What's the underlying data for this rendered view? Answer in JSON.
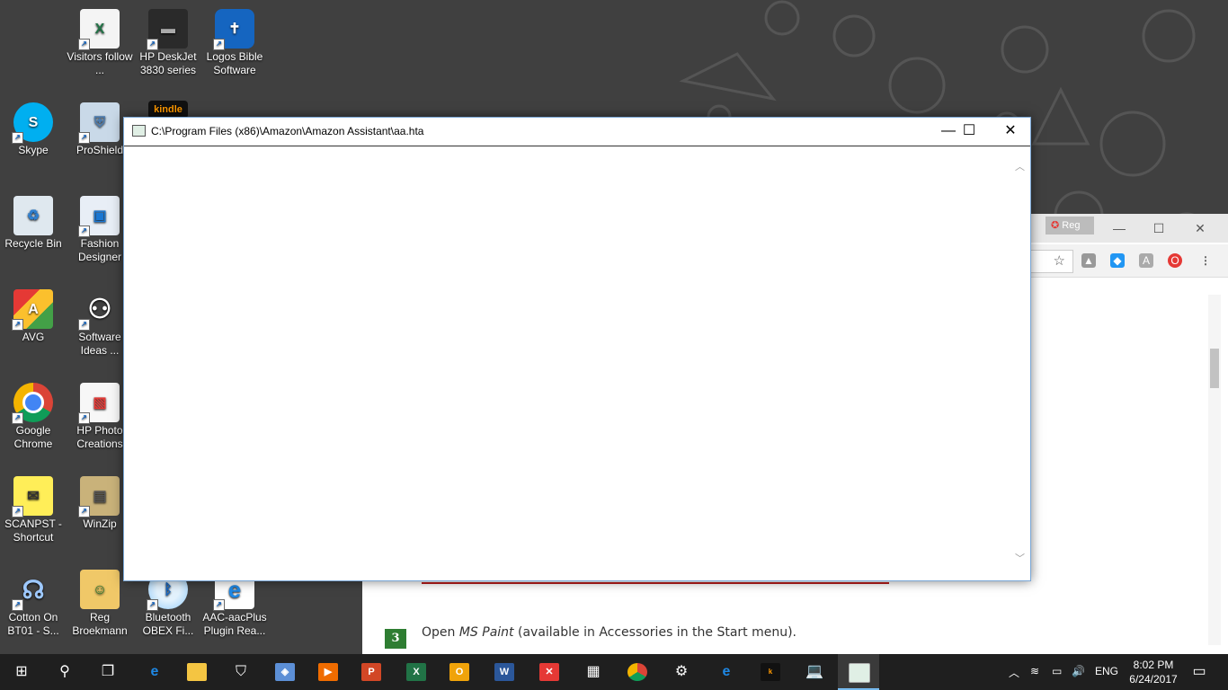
{
  "desktop": {
    "icons": [
      {
        "label": "Visitors follow ...",
        "icon": "excel-file-icon"
      },
      {
        "label": "HP DeskJet 3830 series",
        "icon": "printer-icon"
      },
      {
        "label": "Logos Bible Software",
        "icon": "logos-icon"
      },
      {
        "label": "Skype",
        "icon": "skype-icon"
      },
      {
        "label": "ProShield",
        "icon": "shield-icon"
      },
      {
        "label": "kindle",
        "icon": "kindle-icon"
      },
      {
        "label": "Recycle Bin",
        "icon": "recycle-bin-icon"
      },
      {
        "label": "Fashion Designer",
        "icon": "fashion-designer-icon"
      },
      {
        "label": "AVG",
        "icon": "avg-icon"
      },
      {
        "label": "Software Ideas ...",
        "icon": "software-ideas-icon"
      },
      {
        "label": "Google Chrome",
        "icon": "chrome-icon"
      },
      {
        "label": "HP Photo Creations",
        "icon": "hp-photo-icon"
      },
      {
        "label": "SCANPST - Shortcut",
        "icon": "scanpst-icon"
      },
      {
        "label": "WinZip",
        "icon": "winzip-icon"
      },
      {
        "label": "Cotton On BT01 - S...",
        "icon": "headset-icon"
      },
      {
        "label": "Reg Broekmann",
        "icon": "user-folder-icon"
      },
      {
        "label": "Bluetooth OBEX Fi...",
        "icon": "bluetooth-icon"
      },
      {
        "label": "AAC-aacPlus Plugin Rea...",
        "icon": "ie-file-icon"
      }
    ]
  },
  "browser": {
    "tab_label": "Reg",
    "step_number": "3",
    "step_text_before": "Open ",
    "step_text_em": "MS Paint",
    "step_text_after": " (available in Accessories in the Start menu).",
    "colors": {
      "step_badge": "#2e7d32",
      "divider": "#b71c1c"
    }
  },
  "hta_window": {
    "title": "C:\\Program Files (x86)\\Amazon\\Amazon Assistant\\aa.hta",
    "minimize": "—",
    "maximize": "☐",
    "close": "✕"
  },
  "taskbar": {
    "pinned": [
      "start-icon",
      "search-icon",
      "task-view-icon",
      "edge-icon",
      "file-explorer-icon",
      "store-icon",
      "network-app-icon",
      "media-player-icon",
      "powerpoint-icon",
      "excel-icon",
      "outlook-icon",
      "word-icon",
      "x-app-icon",
      "calculator-icon",
      "chrome-icon",
      "settings-icon",
      "internet-explorer-icon",
      "kindle-icon",
      "laptop-icon",
      "hta-window-icon"
    ],
    "language": "ENG",
    "time": "8:02 PM",
    "date": "6/24/2017"
  }
}
